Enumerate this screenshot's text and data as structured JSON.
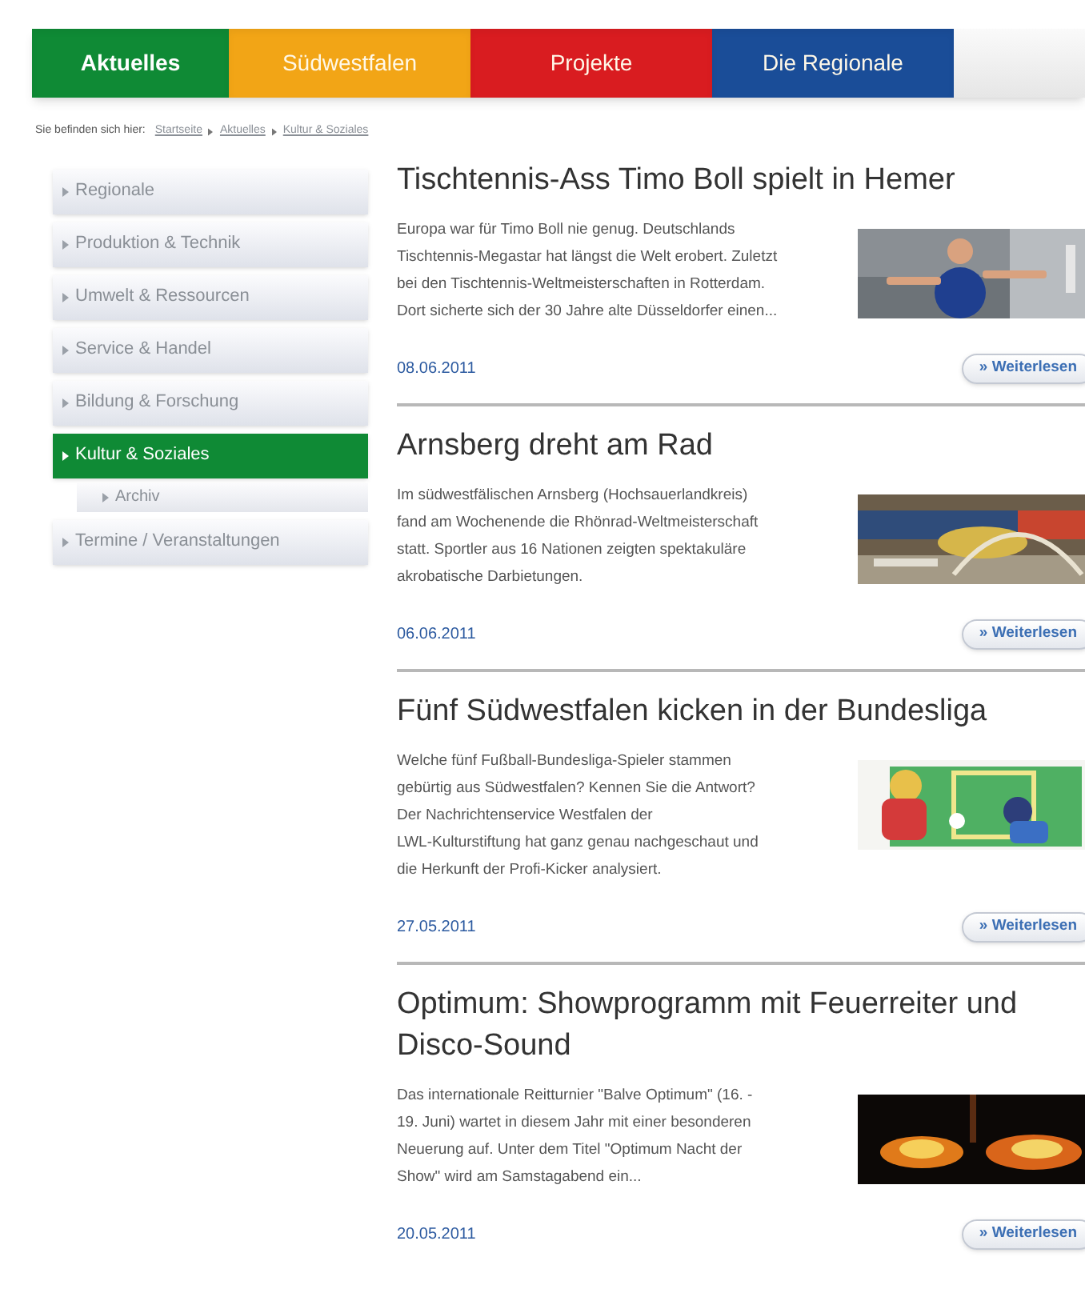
{
  "nav": {
    "tabs": [
      {
        "label": "Aktuelles",
        "color": "#0f8a35",
        "selected": true
      },
      {
        "label": "Südwestfalen",
        "color": "#f2a516",
        "selected": false
      },
      {
        "label": "Projekte",
        "color": "#d91c20",
        "selected": false
      },
      {
        "label": "Die Regionale",
        "color": "#1a4d98",
        "selected": false
      }
    ]
  },
  "breadcrumb": {
    "label": "Sie befinden sich hier:",
    "links": [
      "Startseite",
      "Aktuelles",
      "Kultur & Soziales"
    ]
  },
  "sidebar": {
    "items": [
      {
        "label": "Regionale",
        "selected": false
      },
      {
        "label": "Produktion & Technik",
        "selected": false
      },
      {
        "label": "Umwelt & Ressourcen",
        "selected": false
      },
      {
        "label": "Service & Handel",
        "selected": false
      },
      {
        "label": "Bildung & Forschung",
        "selected": false
      },
      {
        "label": "Kultur & Soziales",
        "selected": true,
        "children": [
          {
            "label": "Archiv",
            "selected": false
          }
        ]
      },
      {
        "label": "Termine / Veranstaltungen",
        "selected": false
      }
    ]
  },
  "articles": [
    {
      "title": "Tischtennis-Ass Timo Boll spielt in Hemer",
      "lines": [
        "Europa war für Timo Boll nie genug. Deutschlands",
        "Tischtennis-Megastar hat längst die Welt erobert. Zuletzt",
        "bei den Tischtennis-Weltmeisterschaften in Rotterdam.",
        "Dort sicherte sich der 30 Jahre alte Düsseldorfer einen..."
      ],
      "date": "08.06.2011",
      "button": "» Weiterlesen",
      "picture": {
        "kind": "picture"
      }
    },
    {
      "title": "Arnsberg dreht am Rad",
      "lines": [
        "Im südwestfälischen Arnsberg (Hochsauerlandkreis)",
        "fand am Wochenende die Rhönrad-Weltmeisterschaft",
        "statt. Sportler aus 16 Nationen zeigten spektakuläre",
        "akrobatische Darbietungen."
      ],
      "date": "06.06.2011",
      "button": "» Weiterlesen",
      "picture": {
        "kind": "picture"
      }
    },
    {
      "title": "Fünf Südwestfalen kicken in der Bundesliga",
      "lines": [
        "Welche fünf Fußball-Bundesliga-Spieler stammen",
        "gebürtig aus Südwestfalen? Kennen Sie die Antwort?",
        "Der Nachrichtenservice Westfalen der",
        "LWL-Kulturstiftung hat ganz genau nachgeschaut und",
        "die Herkunft der Profi-Kicker analysiert."
      ],
      "date": "27.05.2011",
      "button": "» Weiterlesen",
      "picture": {
        "kind": "picture"
      }
    },
    {
      "title": "Optimum: Showprogramm mit Feuerreiter und Disco-Sound",
      "lines": [
        "Das internationale Reitturnier \"Balve Optimum\" (16. -",
        "19. Juni) wartet in diesem Jahr mit einer besonderen",
        "Neuerung auf. Unter dem Titel \"Optimum Nacht der",
        "Show\" wird am Samstagabend ein..."
      ],
      "date": "20.05.2011",
      "button": "» Weiterlesen",
      "picture": {
        "kind": "picture"
      }
    }
  ]
}
